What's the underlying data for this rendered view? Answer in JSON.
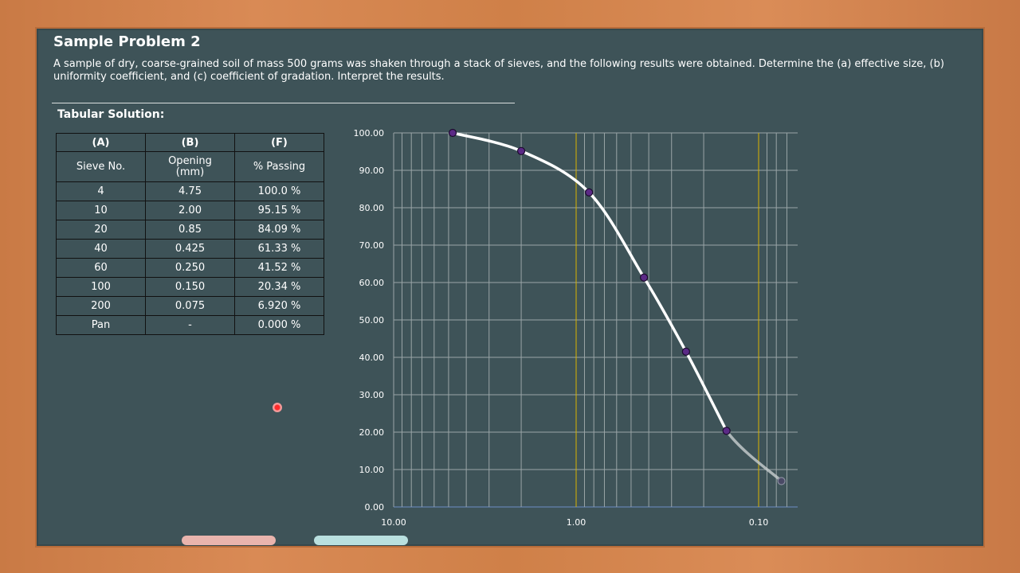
{
  "header": {
    "title": "Sample Problem 2",
    "problem_text": "A sample of dry, coarse-grained soil of mass 500 grams was shaken through a stack of sieves, and the following results were obtained. Determine the (a) effective size, (b) uniformity coefficient, and (c) coefficient of gradation. Interpret the results.",
    "subtitle": "Tabular Solution:"
  },
  "table": {
    "letters": [
      "(A)",
      "(B)",
      "(F)"
    ],
    "headers": [
      "Sieve No.",
      "Opening (mm)",
      "% Passing"
    ],
    "rows": [
      [
        "4",
        "4.75",
        "100.0 %"
      ],
      [
        "10",
        "2.00",
        "95.15 %"
      ],
      [
        "20",
        "0.85",
        "84.09 %"
      ],
      [
        "40",
        "0.425",
        "61.33 %"
      ],
      [
        "60",
        "0.250",
        "41.52 %"
      ],
      [
        "100",
        "0.150",
        "20.34 %"
      ],
      [
        "200",
        "0.075",
        "6.920 %"
      ],
      [
        "Pan",
        "-",
        "0.000 %"
      ]
    ]
  },
  "chart_data": {
    "type": "line",
    "x_scale": "log",
    "x_reversed": true,
    "xlim": [
      10,
      0.07
    ],
    "ylim": [
      0,
      100
    ],
    "x_ticks": [
      10,
      1,
      0.1
    ],
    "x_tick_labels": [
      "10.00",
      "1.00",
      "0.10"
    ],
    "y_ticks": [
      0,
      10,
      20,
      30,
      40,
      50,
      60,
      70,
      80,
      90,
      100
    ],
    "y_tick_labels": [
      "0.00",
      "10.00",
      "20.00",
      "30.00",
      "40.00",
      "50.00",
      "60.00",
      "70.00",
      "80.00",
      "90.00",
      "100.00"
    ],
    "grid": true,
    "series": [
      {
        "points": [
          [
            4.75,
            100.0
          ],
          [
            2.0,
            95.15
          ],
          [
            0.85,
            84.09
          ],
          [
            0.425,
            61.33
          ],
          [
            0.25,
            41.52
          ],
          [
            0.15,
            20.34
          ],
          [
            0.075,
            6.92
          ]
        ]
      }
    ],
    "colors": {
      "curve": "#ffffff",
      "marker": "#5b2a86",
      "highlight_lines": "#d9b300",
      "grid": "#9aa5a7"
    }
  }
}
